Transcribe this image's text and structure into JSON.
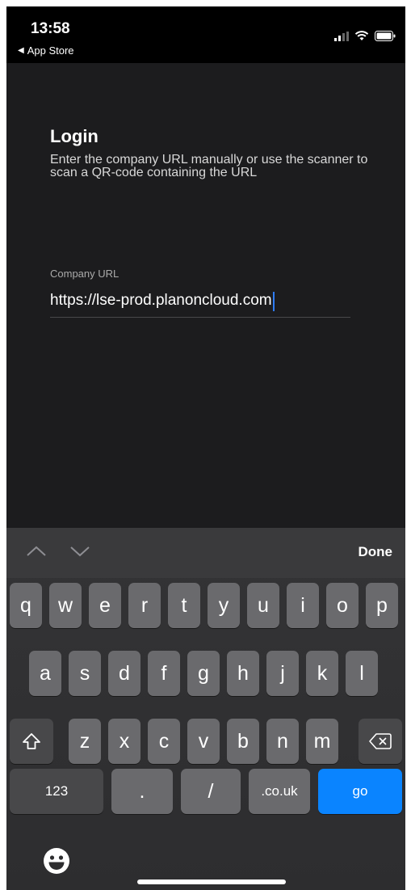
{
  "status_bar": {
    "time": "13:58",
    "back_label": "App Store",
    "icons": [
      "signal-icon",
      "wifi-icon",
      "battery-icon"
    ]
  },
  "login": {
    "title": "Login",
    "description": "Enter the company URL manually or use the scanner to scan a QR-code containing the URL",
    "field_label": "Company URL",
    "url_value": "https://lse-prod.planoncloud.com"
  },
  "accessory": {
    "done_label": "Done"
  },
  "keyboard": {
    "row1": [
      "q",
      "w",
      "e",
      "r",
      "t",
      "y",
      "u",
      "i",
      "o",
      "p"
    ],
    "row2": [
      "a",
      "s",
      "d",
      "f",
      "g",
      "h",
      "j",
      "k",
      "l"
    ],
    "row3": [
      "z",
      "x",
      "c",
      "v",
      "b",
      "n",
      "m"
    ],
    "row4": {
      "numbers": "123",
      "dot": ".",
      "slash": "/",
      "domain": ".co.uk",
      "go": "go"
    }
  },
  "colors": {
    "background": "#1c1c1e",
    "accent": "#0a84ff",
    "key": "#6a6a6d",
    "special_key": "#48484a"
  }
}
